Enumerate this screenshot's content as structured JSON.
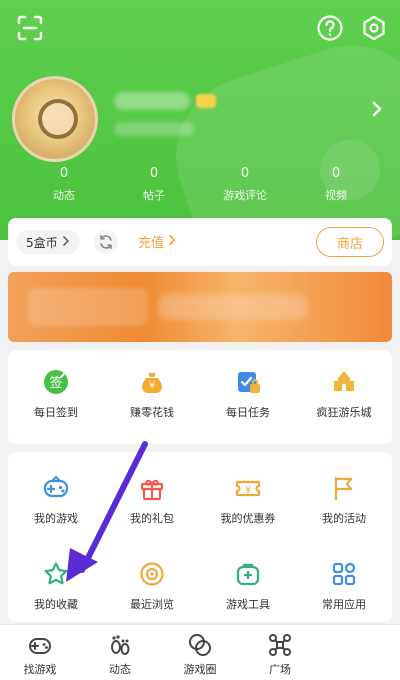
{
  "header": {
    "stats": [
      {
        "value": "0",
        "label": "动态"
      },
      {
        "value": "0",
        "label": "帖子"
      },
      {
        "value": "0",
        "label": "游戏评论"
      },
      {
        "value": "0",
        "label": "视频"
      }
    ],
    "icons": [
      "scan-icon",
      "help-icon",
      "settings-gear-icon",
      "chevron-right-icon"
    ],
    "accent_color": "#4cc23d"
  },
  "wallet": {
    "coins_label": "5盒币",
    "recharge_label": "充值",
    "shop_label": "商店",
    "accent_color": "#f2a340"
  },
  "quick_actions": [
    {
      "label": "每日签到",
      "icon": "checkin-icon"
    },
    {
      "label": "赚零花钱",
      "icon": "money-bag-icon"
    },
    {
      "label": "每日任务",
      "icon": "task-icon"
    },
    {
      "label": "疯狂游乐城",
      "icon": "castle-icon"
    }
  ],
  "features": [
    {
      "label": "我的游戏",
      "icon": "gamepad-icon"
    },
    {
      "label": "我的礼包",
      "icon": "gift-icon"
    },
    {
      "label": "我的优惠券",
      "icon": "coupon-icon"
    },
    {
      "label": "我的活动",
      "icon": "flag-icon"
    },
    {
      "label": "我的收藏",
      "icon": "star-icon"
    },
    {
      "label": "最近浏览",
      "icon": "history-icon"
    },
    {
      "label": "游戏工具",
      "icon": "toolbox-icon"
    },
    {
      "label": "常用应用",
      "icon": "apps-icon"
    }
  ],
  "tabbar": [
    {
      "label": "找游戏",
      "icon": "gamepad-tab-icon"
    },
    {
      "label": "动态",
      "icon": "footprint-icon"
    },
    {
      "label": "游戏圈",
      "icon": "circle-icon"
    },
    {
      "label": "广场",
      "icon": "network-icon"
    }
  ],
  "annotation": {
    "arrow_color": "#5b2bd6"
  }
}
